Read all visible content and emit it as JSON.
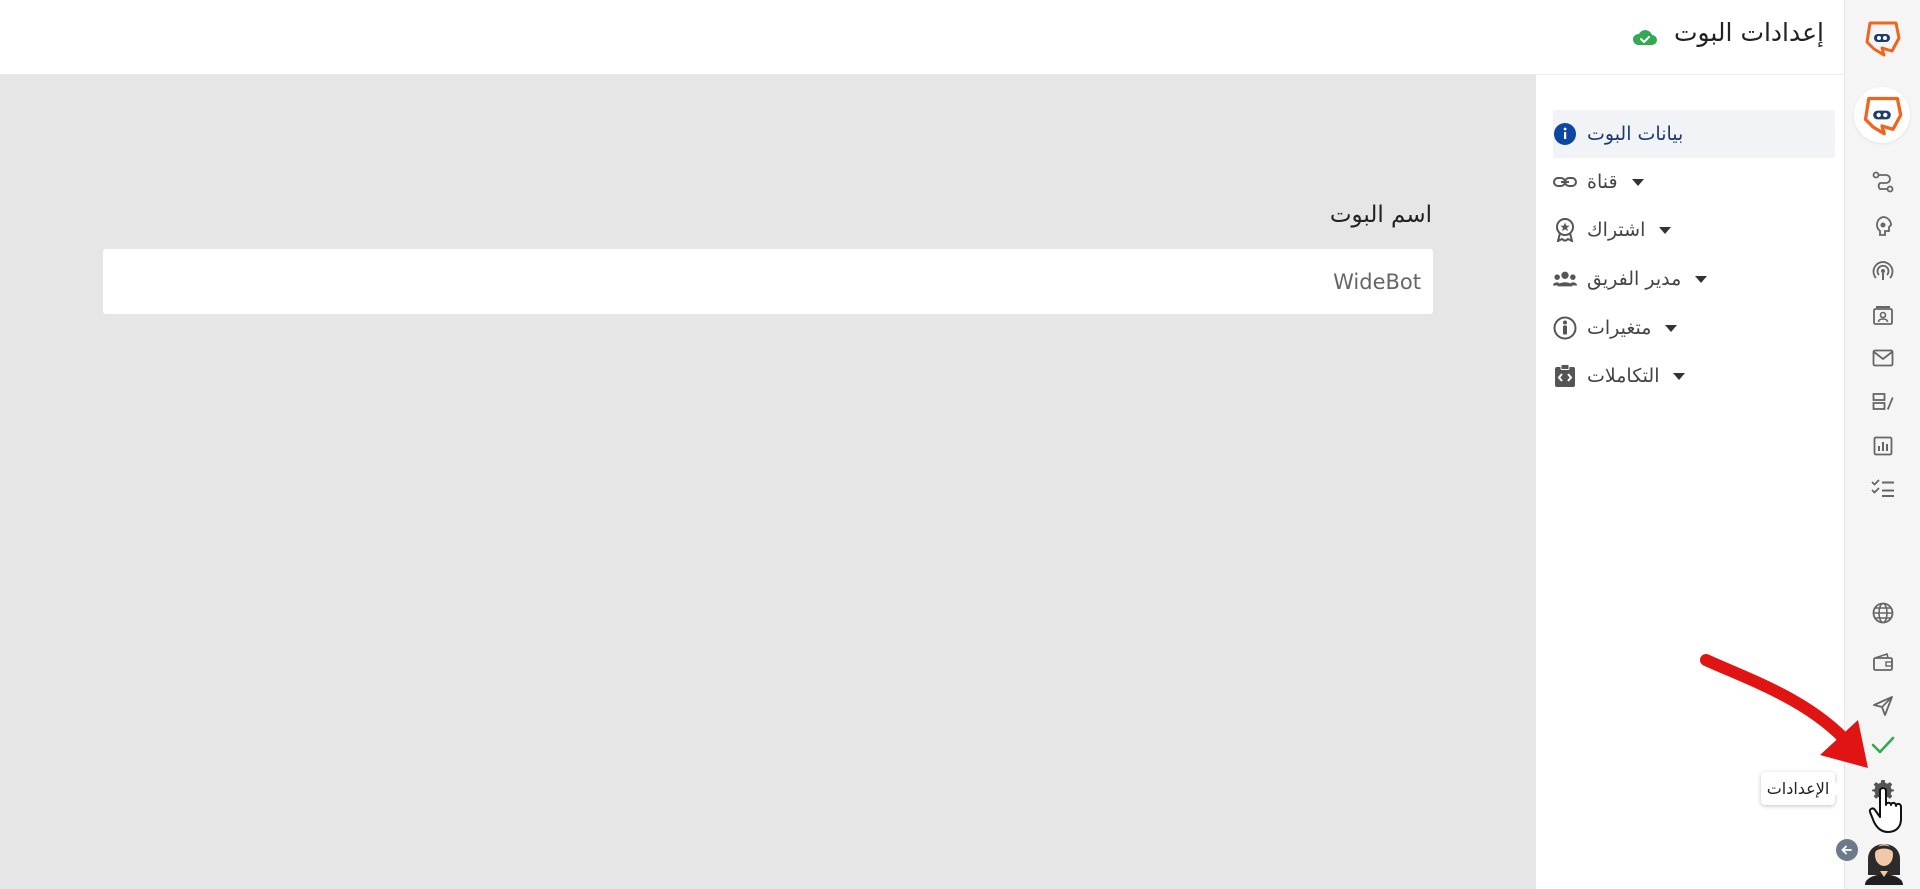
{
  "header": {
    "title": "إعدادات البوت",
    "status_icon": "cloud-check-icon"
  },
  "settings_nav": {
    "items": [
      {
        "label": "بيانات البوت",
        "icon": "info-icon",
        "active": true
      },
      {
        "label": "قناة",
        "icon": "link-icon",
        "active": false
      },
      {
        "label": "اشتراك",
        "icon": "award-icon",
        "active": false
      },
      {
        "label": "مدير الفريق",
        "icon": "users-icon",
        "active": false
      },
      {
        "label": "متغيرات",
        "icon": "person-circle-icon",
        "active": false
      },
      {
        "label": "التكاملات",
        "icon": "code-clipboard-icon",
        "active": false
      }
    ]
  },
  "main": {
    "bot_name_label": "اسم البوت",
    "bot_name_value": "WideBot"
  },
  "tooltip": {
    "text": "الإعدادات"
  },
  "colors": {
    "brand_orange": "#f0641e",
    "brand_navy": "#1e3a6e",
    "active_info": "#0d47a1",
    "success_green": "#34a853",
    "arrow_red": "#e11414"
  }
}
